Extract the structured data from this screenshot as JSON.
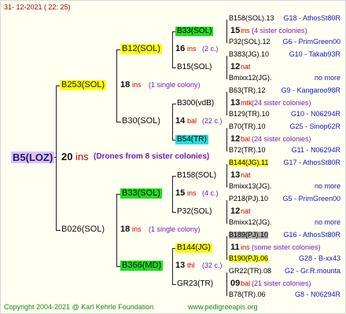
{
  "header": {
    "date": "31- 12-2021 ( 22: 25)"
  },
  "footer": {
    "copyright": "Copyright 2004-2021 @ Karl Kehrle Foundation",
    "site": "www.pedigreeapis.org"
  },
  "root": {
    "id": "B5(LOZ)",
    "year_num": "20",
    "ins": "ins",
    "note": "(Drones from 8 sister colonies)"
  },
  "g1": {
    "upper": {
      "id": "B253(SOL)",
      "num": "18",
      "ins": "ins",
      "note": "(1 single colony)"
    },
    "lower": {
      "id": "B026(SOL)",
      "num": "18",
      "ins": "ins",
      "note": "(1 single colony)"
    }
  },
  "g2": {
    "a": {
      "id": "B12(SOL)",
      "num": "16",
      "ins": "ins",
      "note": "(2 c.)"
    },
    "b": {
      "id": "B30(SOL)",
      "num": "14",
      "ins": "bal",
      "note": "(22 c.)"
    },
    "c": {
      "id": "B33(SOL)",
      "num": "15",
      "ins": "ins",
      "note": "(4 c.)"
    },
    "d": {
      "id": "B366(MD)",
      "num": "13",
      "ins": "thl",
      "note": "(32 c.)"
    }
  },
  "g3": {
    "a1": "B33(SOL)",
    "a2": "B15(SOL)",
    "b1": "B300(vdB)",
    "b2": "B54(TR)",
    "c1": "B158(SOL)",
    "c2": "P32(SOL)",
    "d1": "B144(JG)",
    "d2": "GR23(TR)"
  },
  "g4": [
    {
      "id": "B158(SOL).13",
      "right": "G18 - AthosSt80R"
    },
    {
      "num": "15",
      "ins": "ins",
      "note": "(4 sister colonies)"
    },
    {
      "id": "P32(SOL).12",
      "right": "G6 - PrimGreen00"
    },
    {
      "id": "B383(JG).10",
      "right": "G10 - Takab93R"
    },
    {
      "num": "12",
      "ins": "nat",
      "note": ""
    },
    {
      "id": "Bmixx12(JG).",
      "right": "no more"
    },
    {
      "id": "B63(TR).12",
      "right": "G9 - Kangaroo98R"
    },
    {
      "num": "13",
      "ins": "mtk",
      "note": "(24 sister colonies)"
    },
    {
      "id": "B129(TR).10",
      "right": "G10 - N06294R"
    },
    {
      "id": "B70(TR).10",
      "right": "G25 - Sinop62R"
    },
    {
      "num": "12",
      "ins": "bal",
      "note": "(24 sister colonies)"
    },
    {
      "id": "B72(TR).10",
      "right": "G11 - N06294R"
    },
    {
      "id": "B144(JG).11",
      "right": "G17 - AthosSt80R"
    },
    {
      "num": "13",
      "ins": "nat",
      "note": ""
    },
    {
      "id": "Bmixx13(JG).",
      "right": "no more"
    },
    {
      "id": "P218(PJ).10",
      "right": "G5 - PrimGreen00"
    },
    {
      "num": "12",
      "ins": "nat",
      "note": ""
    },
    {
      "id": "Bmixx12(JG).",
      "right": "no more"
    },
    {
      "id": "B189(PJ).10",
      "right": "G16 - AthosSt80R"
    },
    {
      "num": "11",
      "ins": "ins",
      "note": "(some sister colonies)"
    },
    {
      "id": "B190(PJ).06",
      "right": "G28 - B-xx43"
    },
    {
      "id": "GR22(TR).08",
      "right": "G2 - Gr.R.mounta"
    },
    {
      "num": "09",
      "ins": "bal",
      "note": "(21 sister colonies)"
    },
    {
      "id": "B78(TR).06",
      "right": "G8 - N06294R"
    }
  ]
}
